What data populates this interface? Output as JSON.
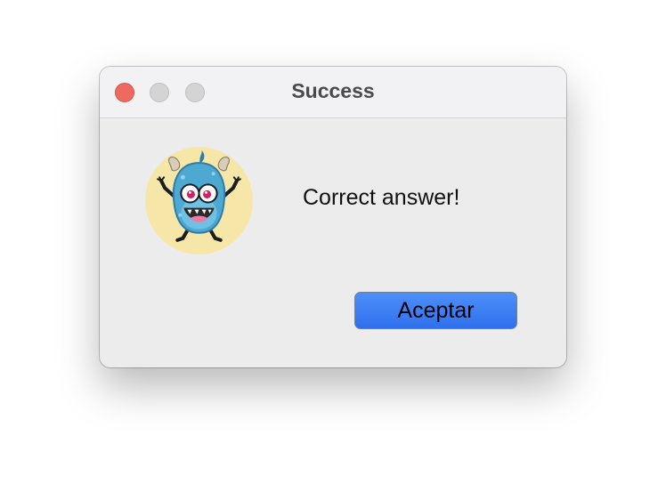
{
  "window": {
    "title": "Success"
  },
  "dialog": {
    "message": "Correct answer!",
    "ok_button_label": "Aceptar"
  },
  "icons": {
    "avatar": "monster-mascot-icon",
    "close": "close-icon",
    "minimize": "minimize-icon",
    "zoom": "zoom-icon"
  },
  "colors": {
    "close_button": "#ee6a5e",
    "inactive_buttons": "#d4d4d4",
    "accent_button": "#3a7ff3",
    "avatar_background": "#f6e7a9",
    "monster_body": "#4da9d2"
  }
}
